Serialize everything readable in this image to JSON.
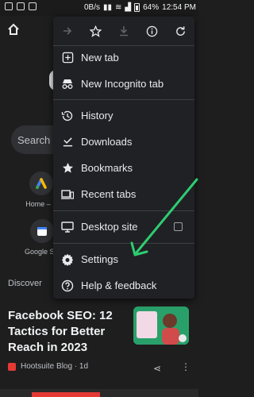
{
  "status_bar": {
    "network_speed": "0B/s",
    "battery": "64%",
    "time": "12:54 PM"
  },
  "page": {
    "search_placeholder": "Search o",
    "tiles": [
      {
        "label": "Home –"
      },
      {
        "label": "Google S"
      }
    ],
    "discover_label": "Discover",
    "article": {
      "title": "Facebook SEO: 12 Tactics for Better Reach in 2023",
      "source": "Hootsuite Blog · 1d"
    }
  },
  "menu": {
    "toolbar": [
      {
        "name": "forward-icon",
        "enabled": false
      },
      {
        "name": "bookmark-star-icon",
        "enabled": true
      },
      {
        "name": "download-icon",
        "enabled": false
      },
      {
        "name": "info-icon",
        "enabled": true
      },
      {
        "name": "refresh-icon",
        "enabled": true
      }
    ],
    "items": [
      {
        "label": "New tab",
        "icon": "plus-box-icon"
      },
      {
        "label": "New Incognito tab",
        "icon": "incognito-icon"
      },
      {
        "label": "History",
        "icon": "history-icon"
      },
      {
        "label": "Downloads",
        "icon": "download-check-icon"
      },
      {
        "label": "Bookmarks",
        "icon": "star-icon"
      },
      {
        "label": "Recent tabs",
        "icon": "devices-icon"
      },
      {
        "label": "Desktop site",
        "icon": "monitor-icon",
        "checked": false
      },
      {
        "label": "Settings",
        "icon": "settings-icon"
      },
      {
        "label": "Help & feedback",
        "icon": "help-icon"
      }
    ]
  },
  "colors": {
    "background": "#1e1e1e",
    "menu_bg": "#202124",
    "annotation_arrow": "#2ecc71"
  }
}
